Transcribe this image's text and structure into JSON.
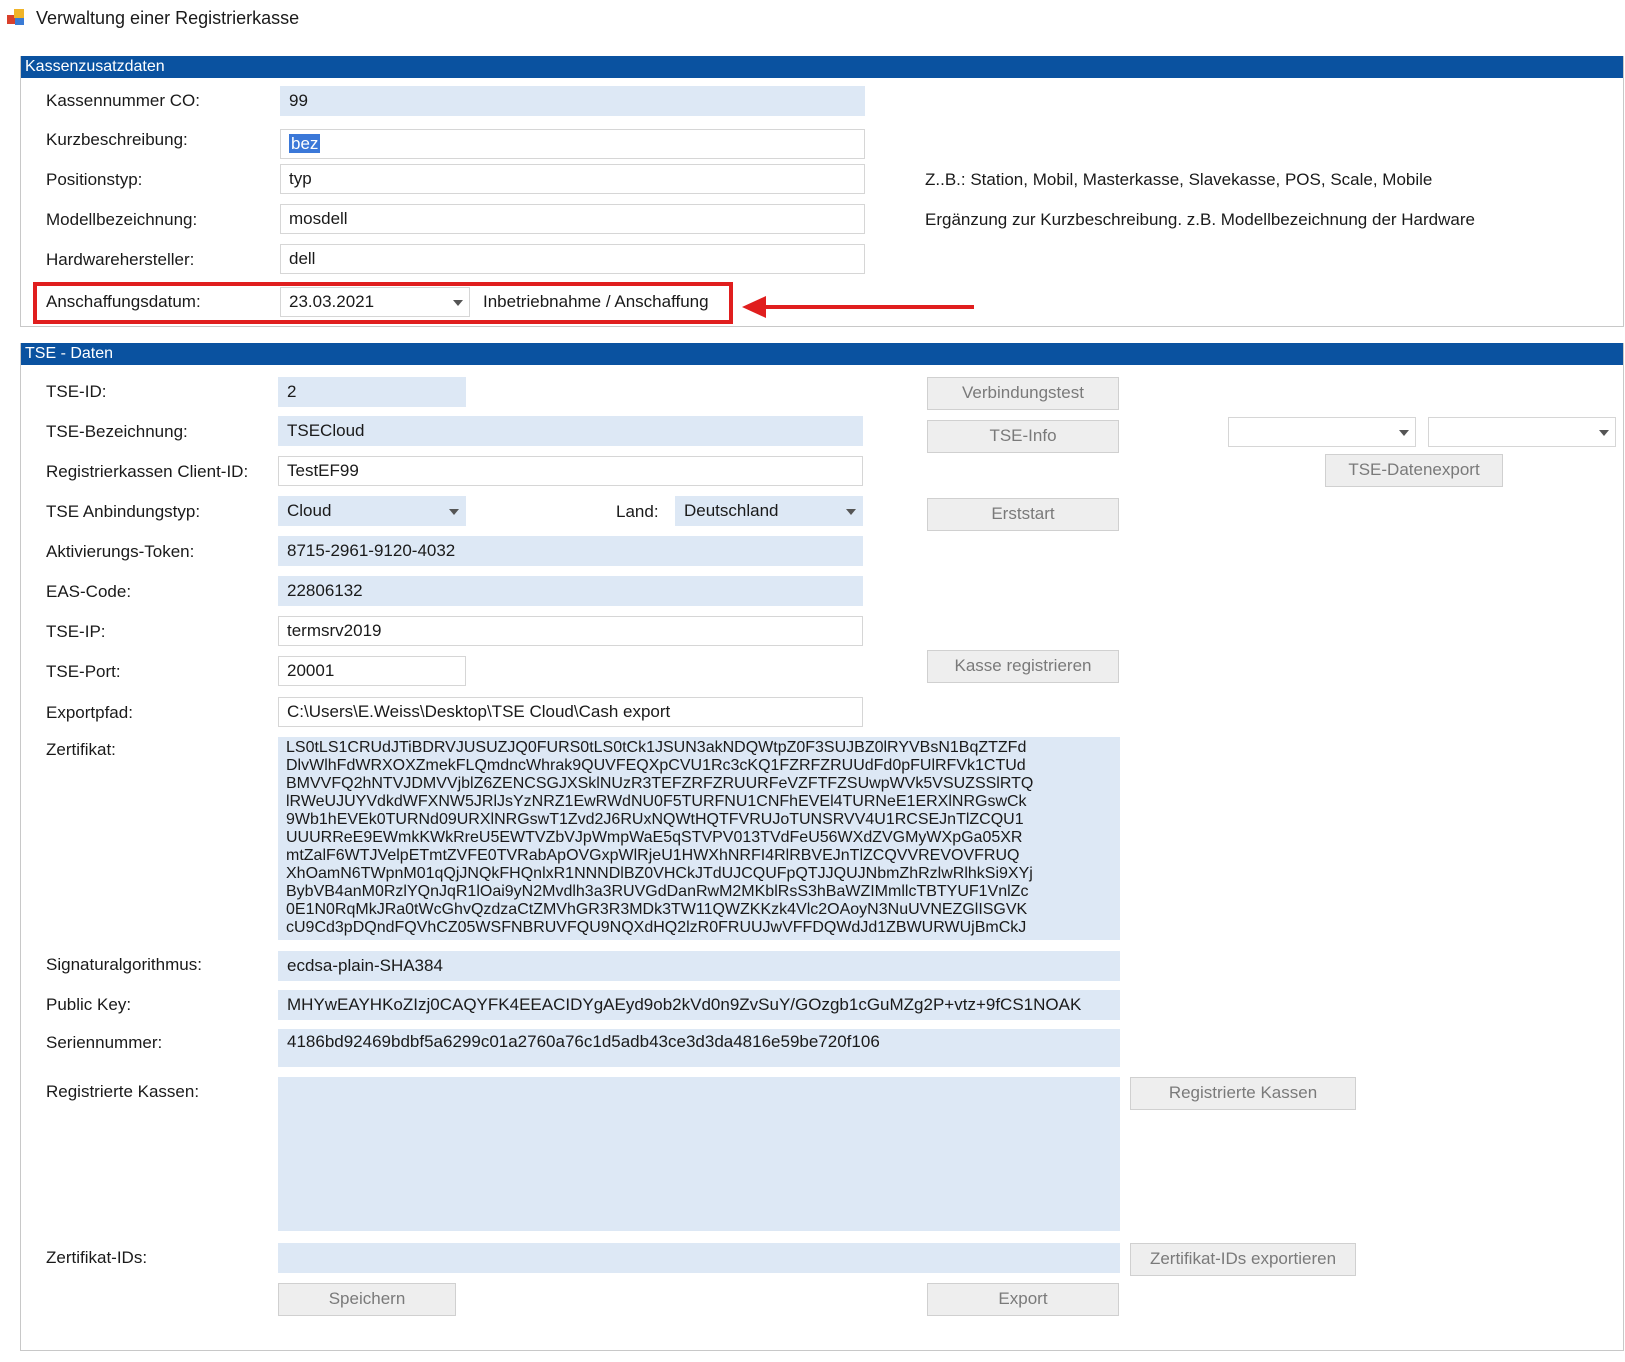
{
  "window": {
    "title": "Verwaltung einer Registrierkasse"
  },
  "kasse": {
    "header": "Kassenzusatzdaten",
    "fields": {
      "kassennummer": {
        "label": "Kassennummer CO:",
        "value": "99"
      },
      "kurzbeschreibung": {
        "label": "Kurzbeschreibung:",
        "value": "bez"
      },
      "positionstyp": {
        "label": "Positionstyp:",
        "value": "typ",
        "hint": "Z..B.: Station, Mobil, Masterkasse, Slavekasse, POS, Scale, Mobile"
      },
      "modell": {
        "label": "Modellbezeichnung:",
        "value": "mosdell",
        "hint": "Ergänzung zur Kurzbeschreibung. z.B. Modellbezeichnung der Hardware"
      },
      "hersteller": {
        "label": "Hardwarehersteller:",
        "value": "dell"
      },
      "anschaffung": {
        "label": "Anschaffungsdatum:",
        "value": "23.03.2021",
        "hint": "Inbetriebnahme / Anschaffung"
      }
    }
  },
  "annotation": {
    "color": "#e01e1e"
  },
  "tse": {
    "header": "TSE - Daten",
    "fields": {
      "id": {
        "label": "TSE-ID:",
        "value": "2"
      },
      "bezeichnung": {
        "label": "TSE-Bezeichnung:",
        "value": "TSECloud"
      },
      "client_id": {
        "label": "Registrierkassen Client-ID:",
        "value": "TestEF99"
      },
      "anbindung": {
        "label": "TSE Anbindungstyp:",
        "value": "Cloud"
      },
      "land": {
        "label": "Land:",
        "value": "Deutschland"
      },
      "token": {
        "label": "Aktivierungs-Token:",
        "value": "8715-2961-9120-4032"
      },
      "eas": {
        "label": "EAS-Code:",
        "value": "22806132"
      },
      "ip": {
        "label": "TSE-IP:",
        "value": "termsrv2019"
      },
      "port": {
        "label": "TSE-Port:",
        "value": "20001"
      },
      "exportpfad": {
        "label": "Exportpfad:",
        "value": "C:\\Users\\E.Weiss\\Desktop\\TSE Cloud\\Cash export"
      },
      "zertifikat": {
        "label": "Zertifikat:",
        "lines": [
          "LS0tLS1CRUdJTiBDRVJUSUZJQ0FURS0tLS0tCk1JSUN3akNDQWtpZ0F3SUJBZ0lRYVBsN1BqZTZFd",
          "DlvWlhFdWRXOXZmekFLQmdncWhrak9QUVFEQXpCVU1Rc3cKQ1FZRFZRUUdFd0pFUlRFVk1CTUd",
          "BMVVFQ2hNTVJDMVVjblZ6ZENCSGJXSklNUzR3TEFZRFZRUURFeVZFTFZSUwpWVk5VSUZSSlRTQ",
          "lRWeUJUYVdkdWFXNW5JRlJsYzNRZ1EwRWdNU0F5TURFNU1CNFhEVEl4TURNeE1ERXlNRGswCk",
          "9Wb1hEVEk0TURNd09URXlNRGswT1Zvd2J6RUxNQWtHQTFVRUJoTUNSRVV4U1RCSEJnTlZCQU1",
          "UUURReE9EWmkKWkRreU5EWTVZbVJpWmpWaE5qSTVPV013TVdFeU56WXdZVGMyWXpGa05XR",
          "mtZalF6WTJVelpETmtZVFE0TVRabApOVGxpWlRjeU1HWXhNRFI4RlRBVEJnTlZCQVVREVOVFRUQ",
          "XhOamN6TWpnM01qQjJNQkFHQnlxR1NNNDlBZ0VHCkJTdUJCQUFpQTJJQUJNbmZhRzlwRlhkSi9XYj",
          "BybVB4anM0RzlYQnJqR1lOai9yN2Mvdlh3a3RUVGdDanRwM2MKblRsS3hBaWZIMmllcTBTYUF1VnlZc",
          "0E1N0RqMkJRa0tWcGhvQzdzaCtZMVhGR3R3MDk3TW11QWZKKzk4Vlc2OAoyN3NuUVNEZGlISGVK",
          "cU9Cd3pDQndFQVhCZ05WSFNBRUVFQU9NQXdHQ2lzR0FRUUJwVFFDQWdJd1ZBWURWUjBmCkJ"
        ]
      },
      "algo": {
        "label": "Signaturalgorithmus:",
        "value": "ecdsa-plain-SHA384"
      },
      "pubkey": {
        "label": "Public Key:",
        "value": "MHYwEAYHKoZIzj0CAQYFK4EEACIDYgAEyd9ob2kVd0n9ZvSuY/GOzgb1cGuMZg2P+vtz+9fCS1NOAK"
      },
      "serien": {
        "label": "Seriennummer:",
        "value": "4186bd92469bdbf5a6299c01a2760a76c1d5adb43ce3d3da4816e59be720f106"
      },
      "reg_kassen": {
        "label": "Registrierte Kassen:",
        "value": ""
      },
      "zert_ids": {
        "label": "Zertifikat-IDs:",
        "value": ""
      }
    },
    "buttons": {
      "verbindungstest": "Verbindungstest",
      "tse_info": "TSE-Info",
      "datenexport": "TSE-Datenexport",
      "erststart": "Erststart",
      "kasse_registrieren": "Kasse registrieren",
      "registrierte_kassen": "Registrierte Kassen",
      "zert_ids_export": "Zertifikat-IDs exportieren",
      "speichern": "Speichern",
      "export": "Export"
    },
    "export_combo_1": {
      "value": ""
    },
    "export_combo_2": {
      "value": ""
    }
  }
}
